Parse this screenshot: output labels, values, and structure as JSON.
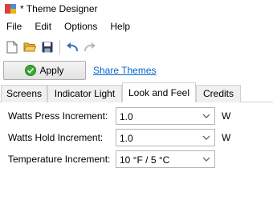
{
  "window": {
    "title": "* Theme Designer"
  },
  "menu": [
    "File",
    "Edit",
    "Options",
    "Help"
  ],
  "toolbar": {
    "icons": [
      "new-file-icon",
      "open-folder-icon",
      "save-icon",
      "undo-icon",
      "redo-icon"
    ]
  },
  "actions": {
    "apply_label": "Apply",
    "share_label": "Share Themes"
  },
  "tabs": [
    "Screens",
    "Indicator Light",
    "Look and Feel",
    "Credits"
  ],
  "active_tab": "Look and Feel",
  "settings": [
    {
      "label": "Watts Press Increment:",
      "value": "1.0",
      "unit": "W"
    },
    {
      "label": "Watts Hold Increment:",
      "value": "1.0",
      "unit": "W"
    },
    {
      "label": "Temperature Increment:",
      "value": "10 °F / 5 °C",
      "unit": ""
    }
  ],
  "colors": {
    "link": "#0066cc",
    "apply_check": "#3aa935"
  }
}
